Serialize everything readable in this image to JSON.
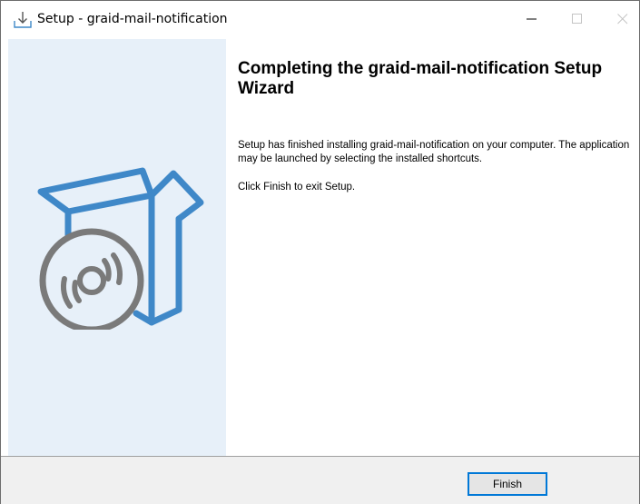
{
  "window": {
    "title": "Setup - graid-mail-notification"
  },
  "icons": {
    "app": "install-download-icon",
    "minimize": "minimize-icon",
    "maximize": "maximize-icon",
    "close": "close-icon",
    "graphic": "software-box-disc-icon"
  },
  "colors": {
    "sidebar_bg": "#e7f0f9",
    "graphic_blue": "#3f88c8",
    "graphic_gray": "#7a7a7a",
    "accent": "#0078d7",
    "footer_bg": "#f0f0f0"
  },
  "content": {
    "heading": "Completing the graid-mail-notification Setup Wizard",
    "finished_text": "Setup has finished installing graid-mail-notification on your computer. The application may be launched by selecting the installed shortcuts.",
    "exit_text": "Click Finish to exit Setup."
  },
  "footer": {
    "finish_label": "Finish"
  }
}
